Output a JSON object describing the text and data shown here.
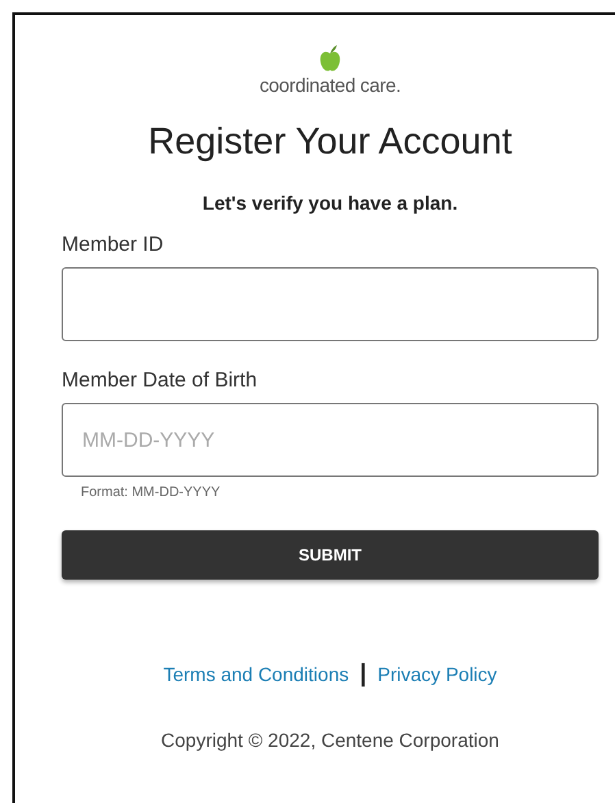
{
  "logo": {
    "text": "coordinated care."
  },
  "title": "Register Your Account",
  "subtitle": "Let's verify you have a plan.",
  "fields": [
    {
      "label": "Member ID"
    },
    {
      "label": "Member Date of Birth",
      "placeholder": "MM-DD-YYYY",
      "hint": "Format: MM-DD-YYYY"
    }
  ],
  "submit": "SUBMIT",
  "links": [
    "Terms and Conditions",
    "Privacy Policy"
  ],
  "separator": "|",
  "copyright": "Copyright © 2022, Centene Corporation"
}
